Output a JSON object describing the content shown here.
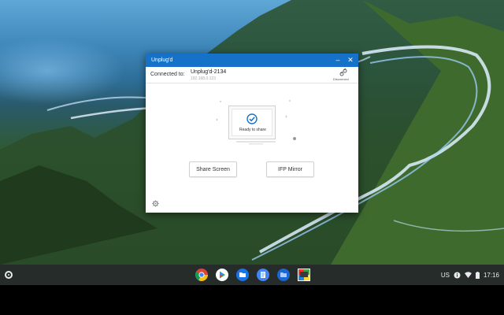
{
  "window": {
    "title": "Unplug'd",
    "connected_label": "Connected to:",
    "device_name": "Unplug'd-2134",
    "device_ip": "192.168.0.123",
    "disconnect_label": "Disconnect",
    "status_text": "Ready to share",
    "share_button": "Share Screen",
    "mirror_button": "IFP Mirror"
  },
  "shelf": {
    "apps": [
      "chrome-icon",
      "play-store-icon",
      "files-icon",
      "docs-icon",
      "files-folder-icon",
      "unplugd-app-icon"
    ]
  },
  "tray": {
    "input_method": "US",
    "time": "17:16"
  },
  "colors": {
    "titlebar": "#1671c9",
    "accent": "#1671c9",
    "taskbar": "#2a302c"
  }
}
